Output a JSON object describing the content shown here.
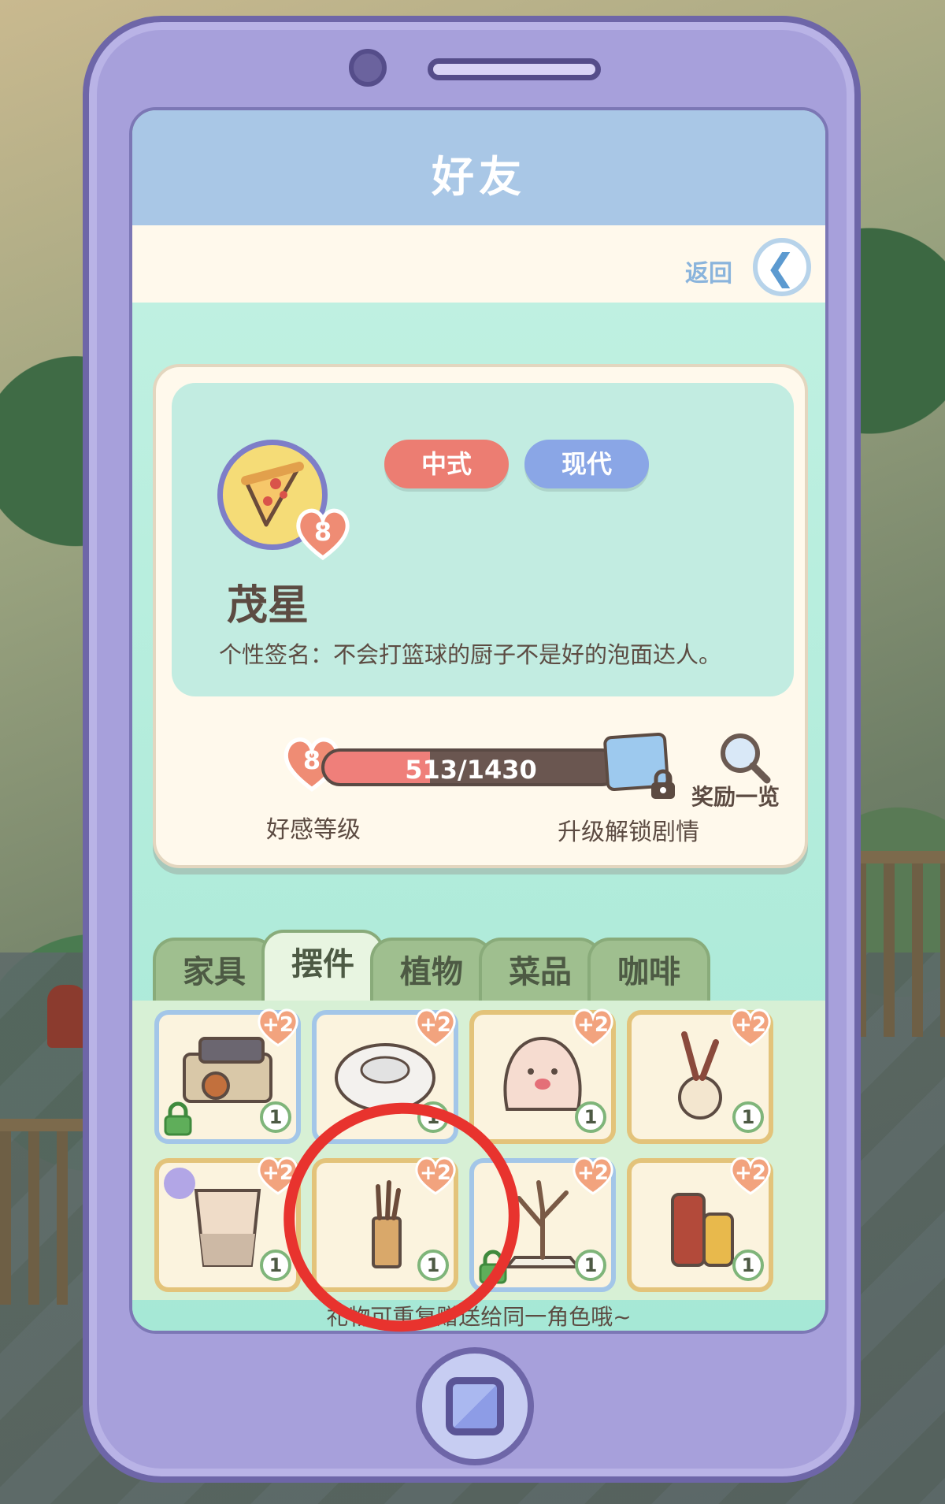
{
  "screen": {
    "title": "好友",
    "back_label": "返回",
    "back_icon": "chevron-left-icon"
  },
  "profile": {
    "tags": [
      "中式",
      "现代"
    ],
    "avatar_icon": "pizza-icon",
    "level": "8",
    "name": "茂星",
    "signature": "个性签名：不会打篮球的厨子不是好的泡面达人。"
  },
  "affection": {
    "level": "8",
    "progress_text": "513/1430",
    "progress_fraction": 0.359,
    "level_label": "好感等级",
    "unlock_label": "升级解锁剧情",
    "reward_label": "奖励一览"
  },
  "tabs": [
    "家具",
    "摆件",
    "植物",
    "菜品",
    "咖啡"
  ],
  "active_tab": "摆件",
  "items": [
    {
      "name": "cooking-station-icon",
      "bonus": "+2",
      "count": "1",
      "locked": true
    },
    {
      "name": "robot-vacuum-icon",
      "bonus": "+2",
      "count": "1",
      "locked": false
    },
    {
      "name": "dumpling-plush-icon",
      "bonus": "+2",
      "count": "1",
      "locked": false
    },
    {
      "name": "feather-vase-icon",
      "bonus": "+2",
      "count": "1",
      "locked": false
    },
    {
      "name": "paper-cup-icon",
      "bonus": "+2",
      "count": "1",
      "locked": false
    },
    {
      "name": "umbrella-stand-icon",
      "bonus": "+2",
      "count": "1",
      "locked": false
    },
    {
      "name": "bare-tree-icon",
      "bonus": "+2",
      "count": "1",
      "locked": true
    },
    {
      "name": "sauce-bottles-icon",
      "bonus": "+2",
      "count": "1",
      "locked": false
    }
  ],
  "hint": "礼物可重复赠送给同一角色哦~",
  "colors": {
    "phone": "#a7a0db",
    "title_bar": "#a9c7e6",
    "tag_red": "#ec7d72",
    "tag_blue": "#8aa6e6",
    "heart": "#ef8c74",
    "annotation_circle": "#e8332e"
  }
}
